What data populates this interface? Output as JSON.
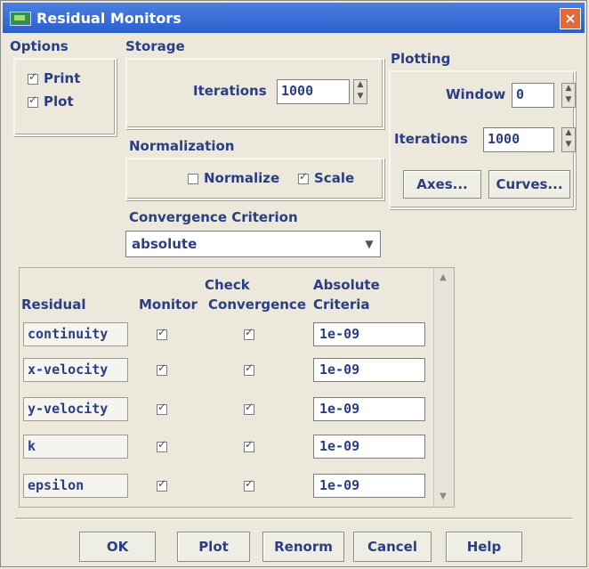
{
  "window": {
    "title": "Residual Monitors",
    "close_glyph": "×"
  },
  "options": {
    "heading": "Options",
    "print_label": "Print",
    "print_checked": true,
    "plot_label": "Plot",
    "plot_checked": true
  },
  "storage": {
    "heading": "Storage",
    "iterations_label": "Iterations",
    "iterations_value": "1000"
  },
  "plotting": {
    "heading": "Plotting",
    "window_label": "Window",
    "window_value": "0",
    "iterations_label": "Iterations",
    "iterations_value": "1000",
    "axes_label": "Axes...",
    "curves_label": "Curves..."
  },
  "normalization": {
    "heading": "Normalization",
    "normalize_label": "Normalize",
    "normalize_checked": false,
    "scale_label": "Scale",
    "scale_checked": true
  },
  "convergence": {
    "heading": "Convergence Criterion",
    "selected": "absolute"
  },
  "table": {
    "col_residual": "Residual",
    "col_monitor": "Monitor",
    "col_check_1": "Check",
    "col_check_2": "Convergence",
    "col_abs_1": "Absolute",
    "col_abs_2": "Criteria",
    "rows": [
      {
        "name": "continuity",
        "monitor": true,
        "check": true,
        "criteria": "1e-09"
      },
      {
        "name": "x-velocity",
        "monitor": true,
        "check": true,
        "criteria": "1e-09"
      },
      {
        "name": "y-velocity",
        "monitor": true,
        "check": true,
        "criteria": "1e-09"
      },
      {
        "name": "k",
        "monitor": true,
        "check": true,
        "criteria": "1e-09"
      },
      {
        "name": "epsilon",
        "monitor": true,
        "check": true,
        "criteria": "1e-09"
      }
    ]
  },
  "buttons": {
    "ok": "OK",
    "plot": "Plot",
    "renorm": "Renorm",
    "cancel": "Cancel",
    "help": "Help"
  }
}
